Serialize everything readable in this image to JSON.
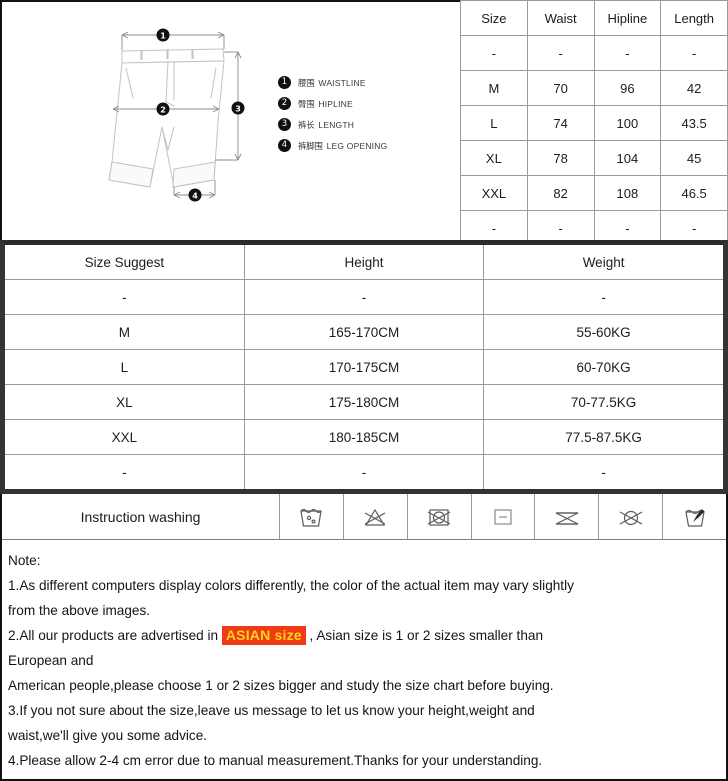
{
  "diagram": {
    "alt": "flat sketch of men's shorts with measurement callouts",
    "markers": [
      "1",
      "2",
      "3",
      "4"
    ],
    "legend": [
      {
        "num": "1",
        "cn": "腰围",
        "en": "WAISTLINE"
      },
      {
        "num": "2",
        "cn": "臀围",
        "en": "HIPLINE"
      },
      {
        "num": "3",
        "cn": "裤长",
        "en": "LENGTH"
      },
      {
        "num": "4",
        "cn": "裤脚围",
        "en": "LEG OPENING"
      }
    ]
  },
  "measurement_table": {
    "headers": [
      "Size",
      "Waist",
      "Hipline",
      "Length"
    ],
    "rows": [
      [
        "-",
        "-",
        "-",
        "-"
      ],
      [
        "M",
        "70",
        "96",
        "42"
      ],
      [
        "L",
        "74",
        "100",
        "43.5"
      ],
      [
        "XL",
        "78",
        "104",
        "45"
      ],
      [
        "XXL",
        "82",
        "108",
        "46.5"
      ],
      [
        "-",
        "-",
        "-",
        "-"
      ]
    ]
  },
  "suggest_table": {
    "headers": [
      "Size Suggest",
      "Height",
      "Weight"
    ],
    "rows": [
      [
        "-",
        "-",
        "-"
      ],
      [
        "M",
        "165-170CM",
        "55-60KG"
      ],
      [
        "L",
        "170-175CM",
        "60-70KG"
      ],
      [
        "XL",
        "175-180CM",
        "70-77.5KG"
      ],
      [
        "XXL",
        "180-185CM",
        "77.5-87.5KG"
      ],
      [
        "-",
        "-",
        "-"
      ]
    ]
  },
  "wash": {
    "label": "Instruction washing",
    "icons": [
      "machine-wash-icon",
      "do-not-bleach-icon",
      "do-not-tumble-dry-icon",
      "dry-flat-icon",
      "do-not-iron-icon",
      "do-not-dry-clean-icon",
      "hand-wash-icon"
    ]
  },
  "notes": {
    "title": "Note:",
    "line1a": "1.As different computers display colors differently, the color of the actual item may vary slightly",
    "line1b": "from the above images.",
    "line2a": "2.All our products are advertised in ",
    "line2_highlight": "ASIAN size",
    "line2b": " , Asian size is 1 or 2 sizes smaller than",
    "line2c": "European and",
    "line2d": "American people,please choose 1 or 2 sizes bigger and study the size chart before buying.",
    "line3a": "3.If you not sure about the size,leave us message to let us know your height,weight and",
    "line3b": "waist,we'll give you some advice.",
    "line4": "4.Please allow 2-4 cm error due to manual measurement.Thanks for your understanding."
  },
  "colors": {
    "highlight_bg": "#ef3b14",
    "highlight_text": "#ffd21e",
    "border_dark": "#111111",
    "border_grey": "#9a9a9a"
  }
}
